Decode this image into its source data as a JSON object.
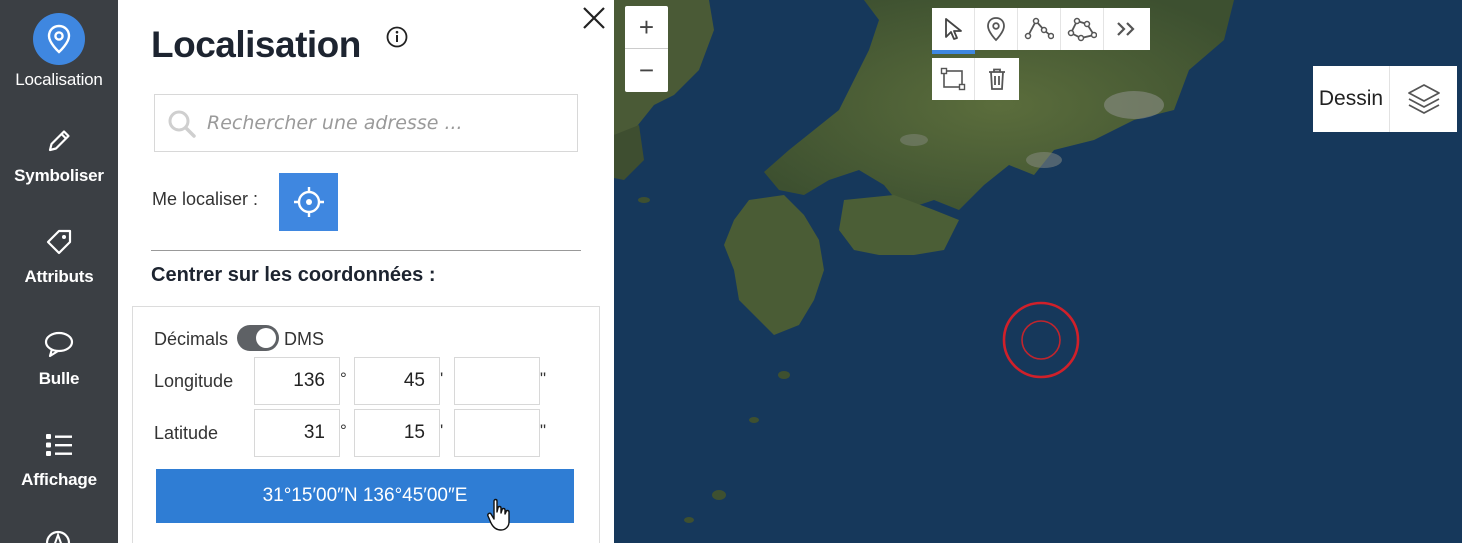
{
  "sidenav": {
    "items": [
      {
        "label": "Localisation",
        "icon": "location-pin-icon",
        "active": true
      },
      {
        "label": "Symboliser",
        "icon": "pencil-icon"
      },
      {
        "label": "Attributs",
        "icon": "tag-icon"
      },
      {
        "label": "Bulle",
        "icon": "speech-bubble-icon"
      },
      {
        "label": "Affichage",
        "icon": "list-icon"
      }
    ]
  },
  "panel": {
    "title": "Localisation",
    "search_placeholder": "Rechercher une adresse ...",
    "locate_label": "Me localiser :",
    "section_title": "Centrer sur les coordonnées :",
    "toggle_left": "Décimals",
    "toggle_right": "DMS",
    "longitude": {
      "label": "Longitude",
      "deg": "136",
      "min": "45",
      "sec": ""
    },
    "latitude": {
      "label": "Latitude",
      "deg": "31",
      "min": "15",
      "sec": ""
    },
    "units": {
      "deg": "°",
      "min": "'",
      "sec": "\""
    },
    "result_button": "31°15′00″N 136°45′00″E"
  },
  "map": {
    "zoom_in": "+",
    "zoom_out": "−",
    "dessin_label": "Dessin"
  },
  "colors": {
    "accent": "#3f87e0",
    "sidenav_bg": "#3b3f44",
    "marker": "#d0202a",
    "sea": "#16385b"
  }
}
